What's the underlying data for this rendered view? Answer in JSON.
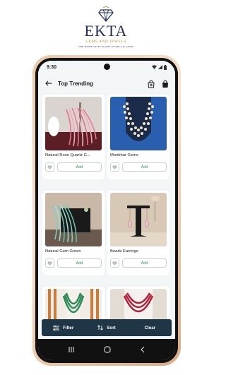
{
  "brand": {
    "name": "EKTA",
    "subtitle": "GEMS AND JEWELS",
    "tagline": "THE HOME OF ELEGANT PEARLS & GEMS",
    "color_primary": "#23305e",
    "color_accent": "#b9923a"
  },
  "status": {
    "time": "9:30",
    "icons": [
      "wifi-icon",
      "signal-icon",
      "battery-icon"
    ]
  },
  "appbar": {
    "title": "Top Trending",
    "back_icon": "arrow-left-icon",
    "actions": [
      "shopping-bag-outline-icon",
      "shopping-bag-icon"
    ]
  },
  "products": [
    {
      "title": "Natural Rose Quartz G...",
      "add_label": "Add",
      "image": "pink-bead-necklaces"
    },
    {
      "title": "Monbhar Gems",
      "add_label": "Add",
      "image": "pearl-necklace"
    },
    {
      "title": "Natural Gem Green",
      "add_label": "Add",
      "image": "green-bead-necklaces"
    },
    {
      "title": "Beads Earrings",
      "add_label": "Add",
      "image": "earrings"
    },
    {
      "title": "",
      "add_label": "",
      "image": "green-multi-strand-necklace"
    },
    {
      "title": "",
      "add_label": "",
      "image": "red-multi-strand-necklace"
    }
  ],
  "bottom_bar": {
    "filter": "Filter",
    "sort": "Sort",
    "clear": "Clear",
    "bg": "#1f3646"
  },
  "colors": {
    "add_text": "#27a043",
    "screen_bg": "#f2f6f7"
  }
}
